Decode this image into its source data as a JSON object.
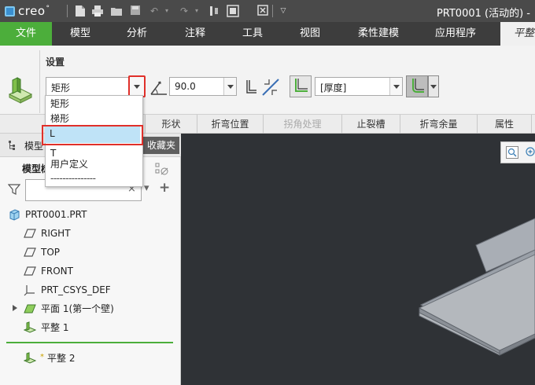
{
  "app": {
    "logo_text": "creo",
    "logo_mark": "°",
    "window_title": "PRT0001 (活动的) -"
  },
  "ribbon_tabs": [
    "文件",
    "模型",
    "分析",
    "注释",
    "工具",
    "视图",
    "柔性建模",
    "应用程序",
    "平整"
  ],
  "ribbon": {
    "group_label": "设置",
    "shape_value": "矩形",
    "angle_value": "90.0",
    "thickness_value": "[厚度]"
  },
  "dropdown": {
    "options": [
      "矩形",
      "梯形",
      "L",
      "T",
      "用户定义",
      "---------------"
    ],
    "selected_index": 2
  },
  "sub_tabs": [
    "形状",
    "折弯位置",
    "拐角处理",
    "止裂槽",
    "折弯余量",
    "属性"
  ],
  "disabled_sub_tab": "拐角处理",
  "model_tree": {
    "tab_model": "模型",
    "tab_favorites": "收藏夹",
    "subheader": "模型树",
    "items": [
      {
        "label": "PRT0001.PRT",
        "icon": "part-icon"
      },
      {
        "label": "RIGHT",
        "icon": "datum-plane-icon"
      },
      {
        "label": "TOP",
        "icon": "datum-plane-icon"
      },
      {
        "label": "FRONT",
        "icon": "datum-plane-icon"
      },
      {
        "label": "PRT_CSYS_DEF",
        "icon": "csys-icon"
      },
      {
        "label": "平面 1(第一个壁)",
        "icon": "planar-wall-icon"
      },
      {
        "label": "平整 1",
        "icon": "flat-wall-icon"
      },
      {
        "label": "平整 2",
        "icon": "flat-wall-icon",
        "marker": "*"
      }
    ]
  },
  "colors": {
    "accent_green": "#4cae3b",
    "highlight_red": "#e0302a",
    "selection_blue": "#bfe3f7",
    "viewport_bg": "#2f3236"
  }
}
